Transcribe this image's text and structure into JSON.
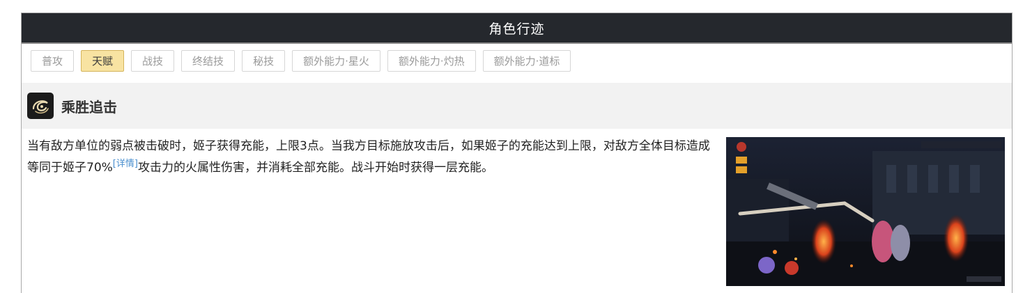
{
  "panel": {
    "title": "角色行迹"
  },
  "tabs": [
    {
      "label": "普攻",
      "active": false
    },
    {
      "label": "天赋",
      "active": true
    },
    {
      "label": "战技",
      "active": false
    },
    {
      "label": "终结技",
      "active": false
    },
    {
      "label": "秘技",
      "active": false
    },
    {
      "label": "额外能力·星火",
      "active": false
    },
    {
      "label": "额外能力·灼热",
      "active": false
    },
    {
      "label": "额外能力·道标",
      "active": false
    }
  ],
  "skill": {
    "icon": "talent-swirl-icon",
    "name": "乘胜追击",
    "description_part1": "当有敌方单位的弱点被击破时，姬子获得充能，上限3点。当我方目标施放攻击后，如果姬子的充能达到上限，对敌方全体目标造成等同于姬子70%",
    "detail_link": "[详情]",
    "description_part2": "攻击力的火属性伤害，并消耗全部充能。战斗开始时获得一层充能。"
  },
  "colors": {
    "header_bg": "#25282d",
    "active_tab_bg": "#f8e3a2",
    "link": "#4a8fcf"
  }
}
